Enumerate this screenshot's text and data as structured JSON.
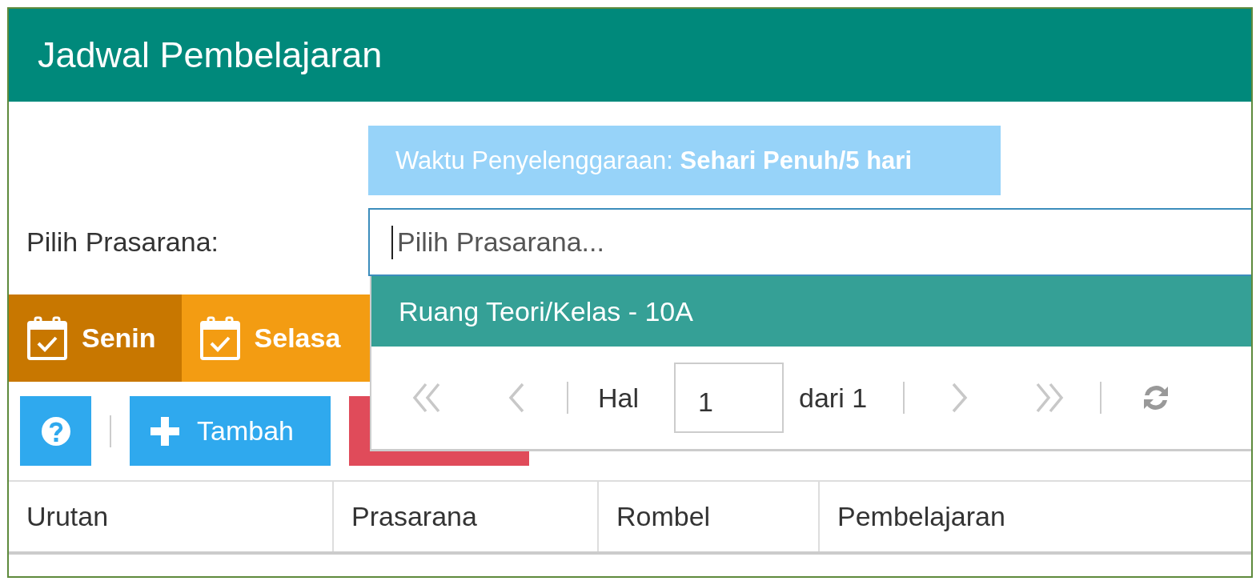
{
  "panel": {
    "title": "Jadwal Pembelajaran"
  },
  "info_banner": "Waktu Penyelenggaraan: **Sehari Penuh/5 hari**",
  "prasarana_field": {
    "label": "Pilih Prasarana:",
    "placeholder": "Pilih Prasarana...",
    "focused": true
  },
  "dropdown": {
    "options": [
      {
        "label": "Ruang Teori/Kelas - 10A",
        "selected": true
      }
    ],
    "pager": {
      "first": {
        "disabled": true
      },
      "prev": {
        "disabled": true
      },
      "page_label": "Hal",
      "page": "1",
      "total": "dari 1",
      "next": {
        "disabled": true
      },
      "last": {
        "disabled": true
      }
    }
  },
  "tabs": [
    {
      "label": "Senin",
      "selected": true
    },
    {
      "label": "Selasa",
      "selected": false
    }
  ],
  "toolbar": [
    {
      "kind": "help"
    },
    {
      "kind": "add",
      "label": "Tambah"
    },
    {
      "kind": "danger"
    }
  ],
  "table": {
    "columns": [
      "Urutan",
      "Prasarana",
      "Rombel",
      "Pembelajaran"
    ]
  }
}
